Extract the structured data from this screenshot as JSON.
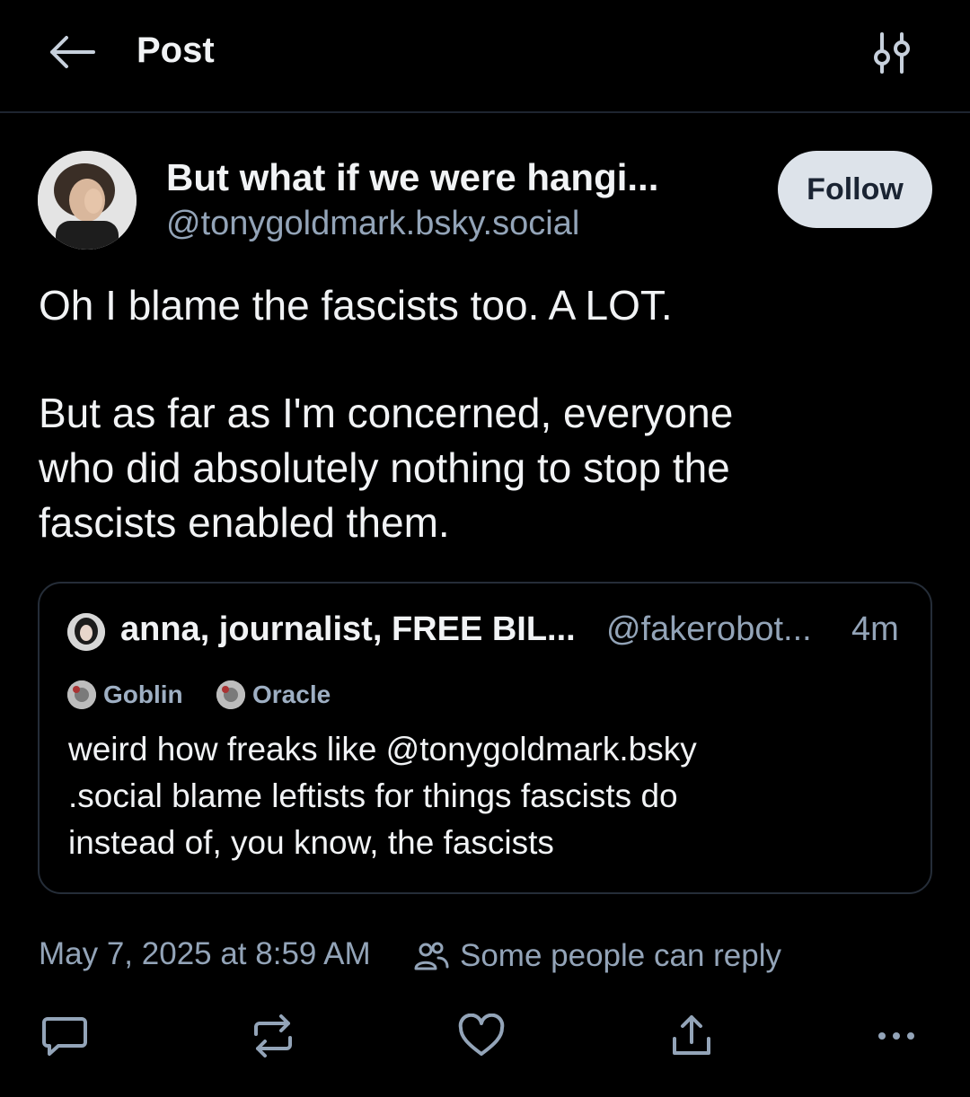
{
  "header": {
    "title": "Post"
  },
  "post": {
    "author_name": "But what if we were hangi...",
    "author_handle": "@tonygoldmark.bsky.social",
    "follow_label": "Follow",
    "text_lines": [
      "Oh I blame the fascists too. A LOT.",
      "But as far as I'm concerned, everyone",
      "who did absolutely nothing to stop the",
      "fascists enabled them."
    ],
    "timestamp": "May 7, 2025 at 8:59 AM",
    "reply_setting": "Some people can reply"
  },
  "quote": {
    "author_name": "anna, journalist, FREE BIL...",
    "author_handle": "@fakerobot...",
    "time": "4m",
    "badges": [
      "Goblin",
      "Oracle"
    ],
    "text_lines": [
      "weird how freaks like @tonygoldmark.bsky",
      ".social blame leftists for things fascists do",
      "instead of, you know, the fascists"
    ]
  },
  "icons": {
    "back": "arrow-left-icon",
    "filter": "sliders-icon",
    "reply": "speech-bubble-icon",
    "repost": "repost-icon",
    "like": "heart-icon",
    "share": "share-icon",
    "more": "ellipsis-icon",
    "people": "people-icon"
  },
  "colors": {
    "background": "#000000",
    "text": "#f1f3f5",
    "muted": "#93a4b8",
    "border": "#252d38",
    "follow_bg": "#dde3ea"
  }
}
